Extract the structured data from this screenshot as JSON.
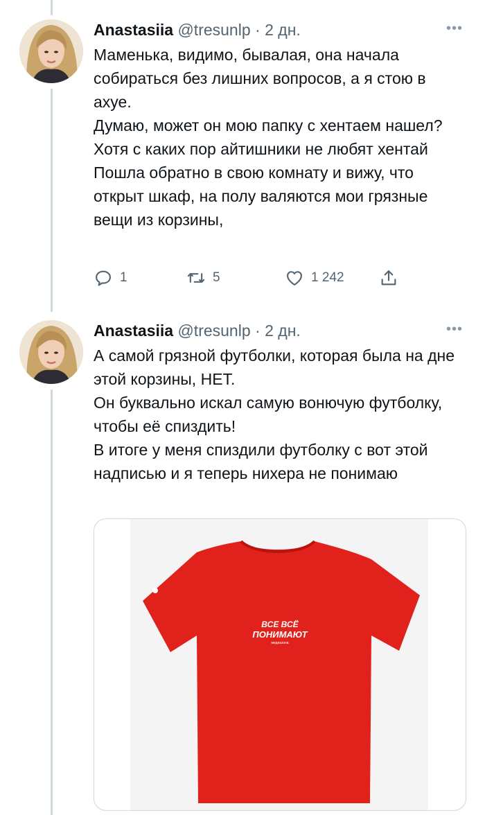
{
  "tweets": [
    {
      "author_name": "Anastasiia",
      "handle": "@tresunlp",
      "separator": "·",
      "time": "2 дн.",
      "more_label": "•••",
      "paragraphs": [
        "Маменька, видимо, бывалая, она начала собираться без лишних вопросов, а я стою в ахуе.",
        "Думаю, может он мою папку с хентаем нашел? Хотя с каких пор айтишники не любят хентай",
        "Пошла обратно в свою комнату и вижу, что открыт шкаф, на полу валяются мои грязные вещи из корзины,"
      ],
      "actions": {
        "replies": "1",
        "retweets": "5",
        "likes": "1 242"
      }
    },
    {
      "author_name": "Anastasiia",
      "handle": "@tresunlp",
      "separator": "·",
      "time": "2 дн.",
      "more_label": "•••",
      "paragraphs": [
        "А самой грязной футболки, которая была на дне этой корзины, НЕТ.",
        "Он буквально искал самую вонючую футболку, чтобы её спиздить!",
        "В итоге у меня спиздили футболку с вот этой надписью и я теперь нихера не понимаю"
      ],
      "media": {
        "shirt_color": "#e0211c",
        "print_line1": "ВСЕ ВСЁ",
        "print_line2": "ПОНИМАЮТ",
        "print_line3": "медиазона"
      }
    }
  ],
  "icons": [
    "reply-icon",
    "retweet-icon",
    "like-icon",
    "share-icon",
    "more-icon"
  ],
  "colors": {
    "text": "#0f1419",
    "secondary": "#536471",
    "thread_line": "#cfd9de"
  }
}
